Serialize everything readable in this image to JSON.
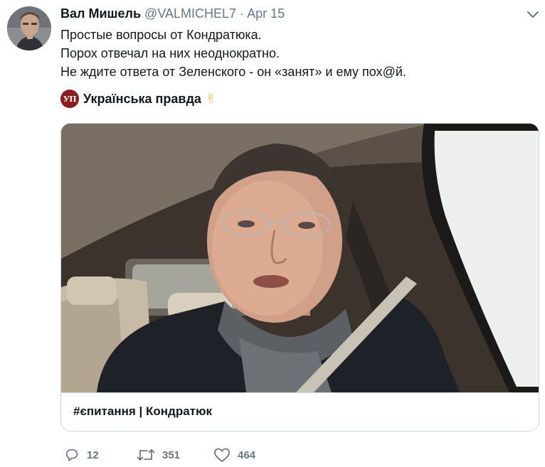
{
  "tweet": {
    "author_name": "Вал Мишель",
    "handle": "@VALMICHEL7",
    "separator": "·",
    "date": "Apr 15",
    "lines": [
      "Простые вопросы от Кондратюка.",
      "Порох отвечал на них неоднократно.",
      "Не ждите ответа от Зеленского - он «занят» и ему пох@й."
    ]
  },
  "source": {
    "logo_text": "УП",
    "name": "Українська правда",
    "emoji": "✌"
  },
  "card": {
    "title": "#єпитання | Кондратюк"
  },
  "actions": {
    "reply_count": "12",
    "retweet_count": "351",
    "like_count": "464"
  },
  "icons": {
    "menu": "chevron-down-icon",
    "reply": "reply-icon",
    "retweet": "retweet-icon",
    "like": "heart-icon"
  },
  "colors": {
    "text": "#14171a",
    "secondary": "#657786",
    "border": "#ccd6dd",
    "logo_bg": "#8d1b1b"
  }
}
